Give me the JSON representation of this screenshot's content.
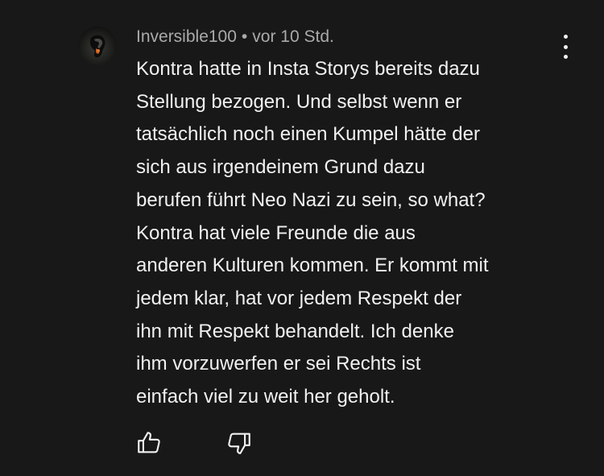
{
  "comment": {
    "author": "Inversible100",
    "separator": "•",
    "time": "vor 10 Std.",
    "avatar_icon": "avatar-icon",
    "lines": [
      "Kontra hatte in Insta Storys bereits dazu",
      "Stellung bezogen. Und selbst wenn er",
      "tatsächlich noch einen Kumpel hätte der",
      "sich aus irgendeinem Grund dazu",
      "berufen führt Neo Nazi zu sein, so what?",
      "Kontra hat viele Freunde die aus",
      "anderen Kulturen kommen. Er kommt mit",
      "jedem klar, hat vor jedem Respekt der",
      "ihn mit Respekt behandelt. Ich denke",
      "ihm vorzuwerfen er sei Rechts ist",
      "einfach viel zu weit her geholt."
    ]
  },
  "actions": {
    "menu_icon": "more-vertical-icon",
    "like_icon": "thumbs-up-icon",
    "dislike_icon": "thumbs-down-icon"
  },
  "colors": {
    "background": "#181818",
    "text_primary": "#f1f1f1",
    "text_secondary": "#aaaaaa"
  }
}
